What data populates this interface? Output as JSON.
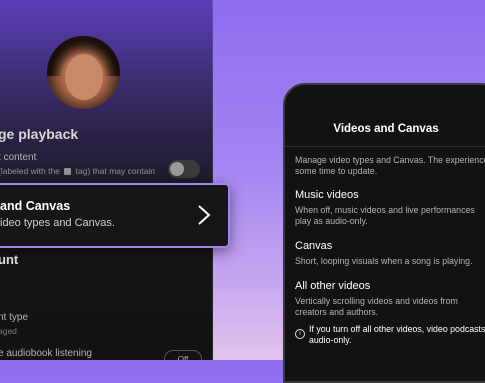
{
  "left_panel": {
    "heading": "ge playback",
    "explicit_label": "t content",
    "explicit_desc_pre": "(labeled with the",
    "explicit_desc_post": "tag) that may contain",
    "section_title": "unt",
    "account_type_label": "nt type",
    "account_type_value": "aged",
    "audiobook_label": "e audiobook listening",
    "audiobook_pill": "Off"
  },
  "card": {
    "title": "and Canvas",
    "subtitle": "ideo types and Canvas."
  },
  "phone": {
    "title": "Videos and Canvas",
    "intro_line1": "Manage video types and Canvas. The experience r",
    "intro_line2": "some time to update.",
    "music": {
      "title": "Music videos",
      "line1": "When off, music videos and live performances",
      "line2": "play as audio-only."
    },
    "canvas": {
      "title": "Canvas",
      "line1": "Short, looping visuals when a song is playing."
    },
    "other": {
      "title": "All other videos",
      "line1": "Vertically scrolling videos and videos from",
      "line2": "creators and authors."
    },
    "note_line1": "If you turn off all other videos, video podcasts pl",
    "note_line2": "audio-only.",
    "info_glyph": "i"
  }
}
